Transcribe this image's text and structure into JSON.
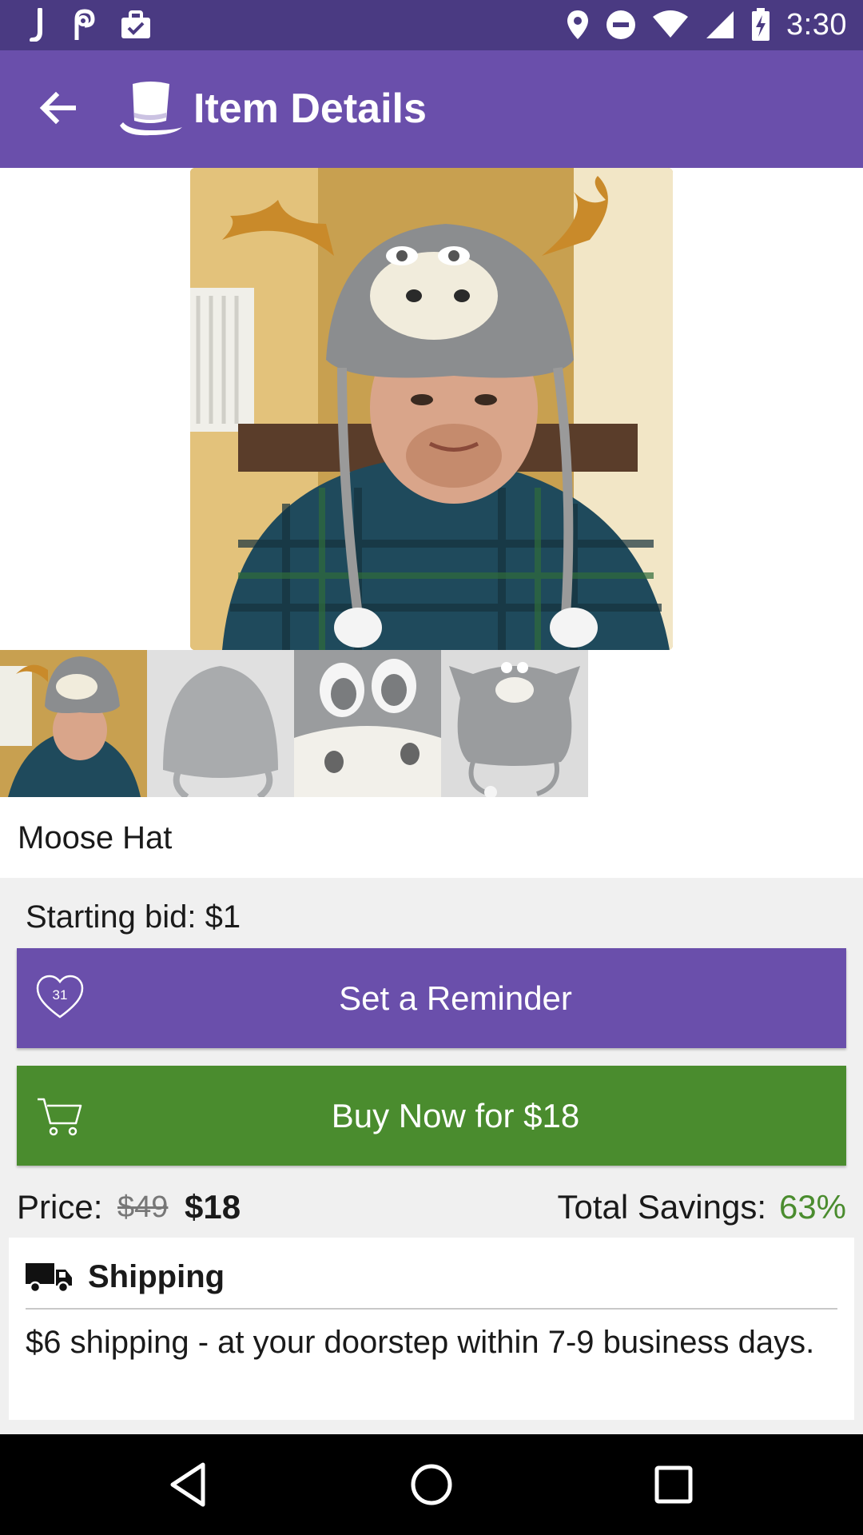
{
  "status_bar": {
    "time": "3:30",
    "left_icons": [
      "j-app-icon",
      "link-app-icon",
      "briefcase-check-icon"
    ],
    "right_icons": [
      "location-icon",
      "do-not-disturb-icon",
      "wifi-icon",
      "cell-signal-icon",
      "battery-charging-icon"
    ]
  },
  "app_bar": {
    "title": "Item Details",
    "back_icon": "arrow-back-icon",
    "logo_icon": "top-hat-icon"
  },
  "item": {
    "title": "Moose Hat",
    "main_image": "photo of person wearing moose hat",
    "thumbnails": [
      "thumbnail-1",
      "thumbnail-2",
      "thumbnail-3",
      "thumbnail-4"
    ]
  },
  "bid": {
    "starting_bid": "Starting bid: $1"
  },
  "buttons": {
    "reminder_label": "Set a Reminder",
    "reminder_badge": "31",
    "buy_label": "Buy Now for $18"
  },
  "price": {
    "label": "Price:",
    "original": "$49",
    "current": "$18",
    "savings_label": "Total Savings:",
    "savings_value": "63%"
  },
  "shipping": {
    "title": "Shipping",
    "description": "$6 shipping - at your doorstep within 7-9 business days."
  },
  "colors": {
    "status_bar": "#4a3a82",
    "app_bar": "#6a4fab",
    "reminder_button": "#6a4fab",
    "buy_button": "#4a8c2e",
    "savings": "#4a8c2e"
  }
}
